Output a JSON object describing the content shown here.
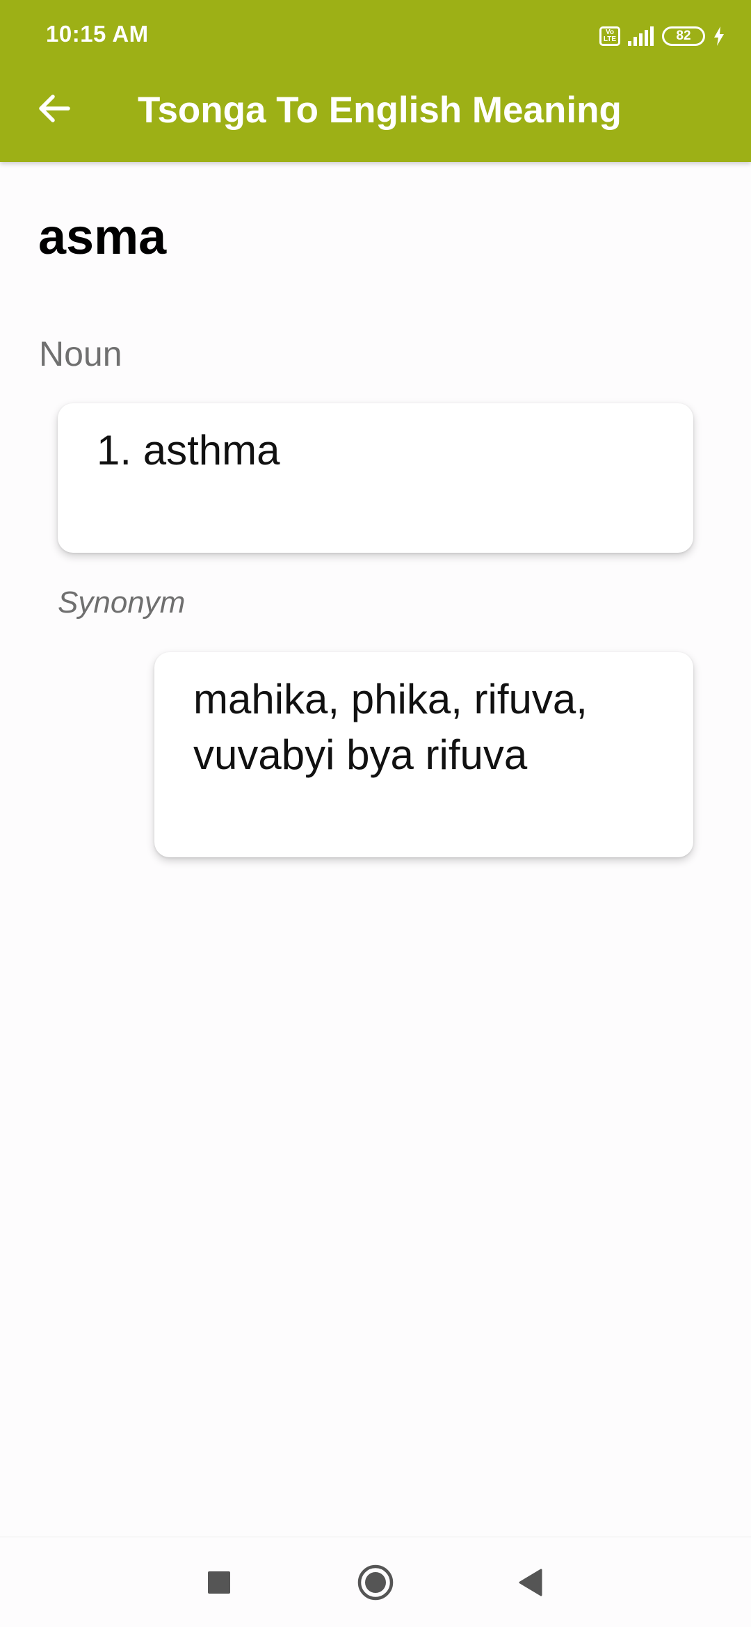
{
  "status_bar": {
    "time": "10:15 AM",
    "volte": "Vo LTE",
    "battery_level": "82"
  },
  "app_bar": {
    "title": "Tsonga To English Meaning",
    "back_icon": "arrow-left-icon"
  },
  "entry": {
    "word": "asma",
    "part_of_speech": "Noun",
    "meanings": [
      "1. asthma"
    ],
    "synonym_label": "Synonym",
    "synonyms": "mahika, phika, rifuva, vuvabyi bya rifuva"
  },
  "nav_bar": {
    "icons": [
      "recents-square-icon",
      "home-circle-icon",
      "back-triangle-icon"
    ]
  },
  "colors": {
    "app_bar": "#9db016",
    "background": "#fdfcfd",
    "card": "#ffffff",
    "muted_text": "#707070"
  }
}
